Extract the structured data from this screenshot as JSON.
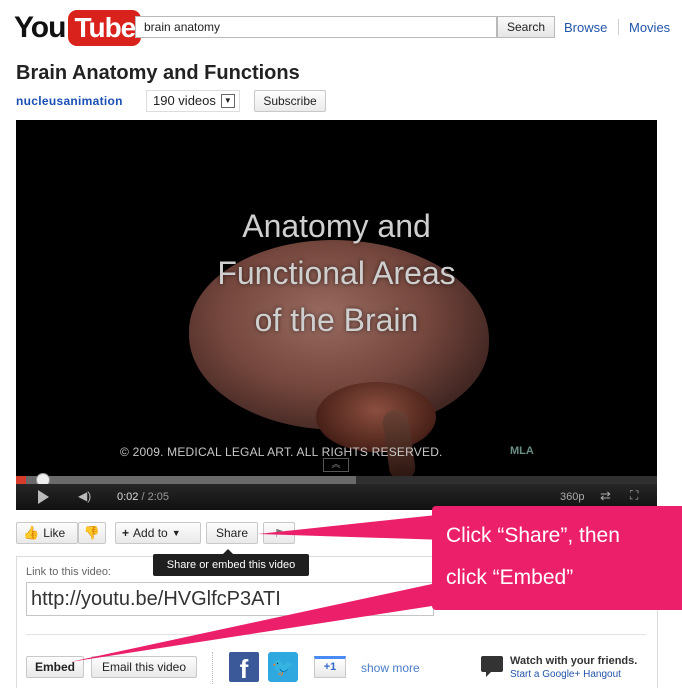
{
  "header": {
    "logo_you": "You",
    "logo_tube": "Tube",
    "search_value": "brain anatomy",
    "search_button": "Search",
    "nav": [
      "Browse",
      "Movies"
    ]
  },
  "video": {
    "title": "Brain Anatomy and Functions",
    "channel": "nucleusanimation",
    "video_count": "190 videos",
    "subscribe_label": "Subscribe"
  },
  "player": {
    "overlay_lines": [
      "Anatomy and",
      "Functional Areas",
      "of the Brain"
    ],
    "copyright": "© 2009. MEDICAL LEGAL ART. ALL RIGHTS RESERVED.",
    "watermark": "MLA",
    "current_time": "0:02",
    "duration": "/ 2:05",
    "quality": "360p",
    "played_fraction": 0.016,
    "loaded_fraction": 0.53
  },
  "actions": {
    "like_label": "Like",
    "add_to_label": "Add to",
    "share_label": "Share",
    "tooltip": "Share or embed this video"
  },
  "share": {
    "link_label": "Link to this video:",
    "link_value": "http://youtu.be/HVGlfcP3ATI",
    "embed_label": "Embed",
    "email_label": "Email this video",
    "plus_one": "+1",
    "show_more": "show more",
    "hangout_title": "Watch with your friends.",
    "hangout_link": "Start a Google+ Hangout"
  },
  "callout": {
    "lines": [
      "Click “Share”, then",
      "click “Embed”"
    ],
    "color": "#ec1f6a"
  }
}
